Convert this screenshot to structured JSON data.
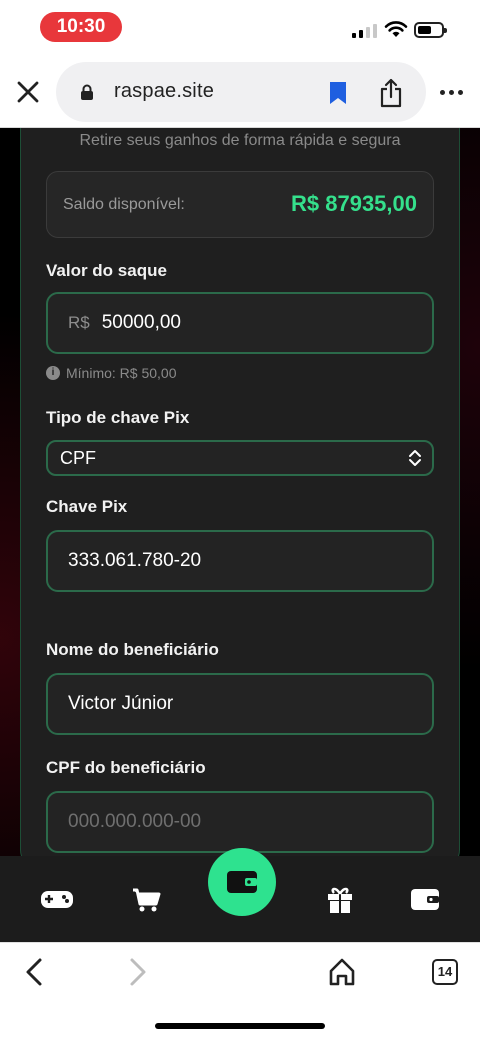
{
  "status_bar": {
    "time": "10:30"
  },
  "browser": {
    "url": "raspae.site",
    "open_tabs": "14"
  },
  "page": {
    "subtitle": "Retire seus ganhos de forma rápida e segura",
    "balance": {
      "label": "Saldo disponível:",
      "value": "R$ 87935,00",
      "color": "#35e08c"
    },
    "withdraw_amount": {
      "label": "Valor do saque",
      "prefix": "R$",
      "value": "50000,00",
      "hint": "Mínimo: R$ 50,00"
    },
    "pix_key_type": {
      "label": "Tipo de chave Pix",
      "selected": "CPF"
    },
    "pix_key": {
      "label": "Chave Pix",
      "value": "333.061.780-20"
    },
    "beneficiary_name": {
      "label": "Nome do beneficiário",
      "value": "Victor Júnior"
    },
    "beneficiary_cpf": {
      "label": "CPF do beneficiário",
      "placeholder": "000.000.000-00"
    }
  },
  "app_nav": {
    "items": [
      "gamepad-icon",
      "cart-icon",
      "wallet-icon",
      "gift-icon",
      "wallet-icon"
    ],
    "active": "wallet-icon",
    "accent": "#2ee28f"
  },
  "safari_toolbar": {
    "icons": [
      "back-icon",
      "forward-icon",
      "home-icon",
      "tabs-icon"
    ]
  }
}
